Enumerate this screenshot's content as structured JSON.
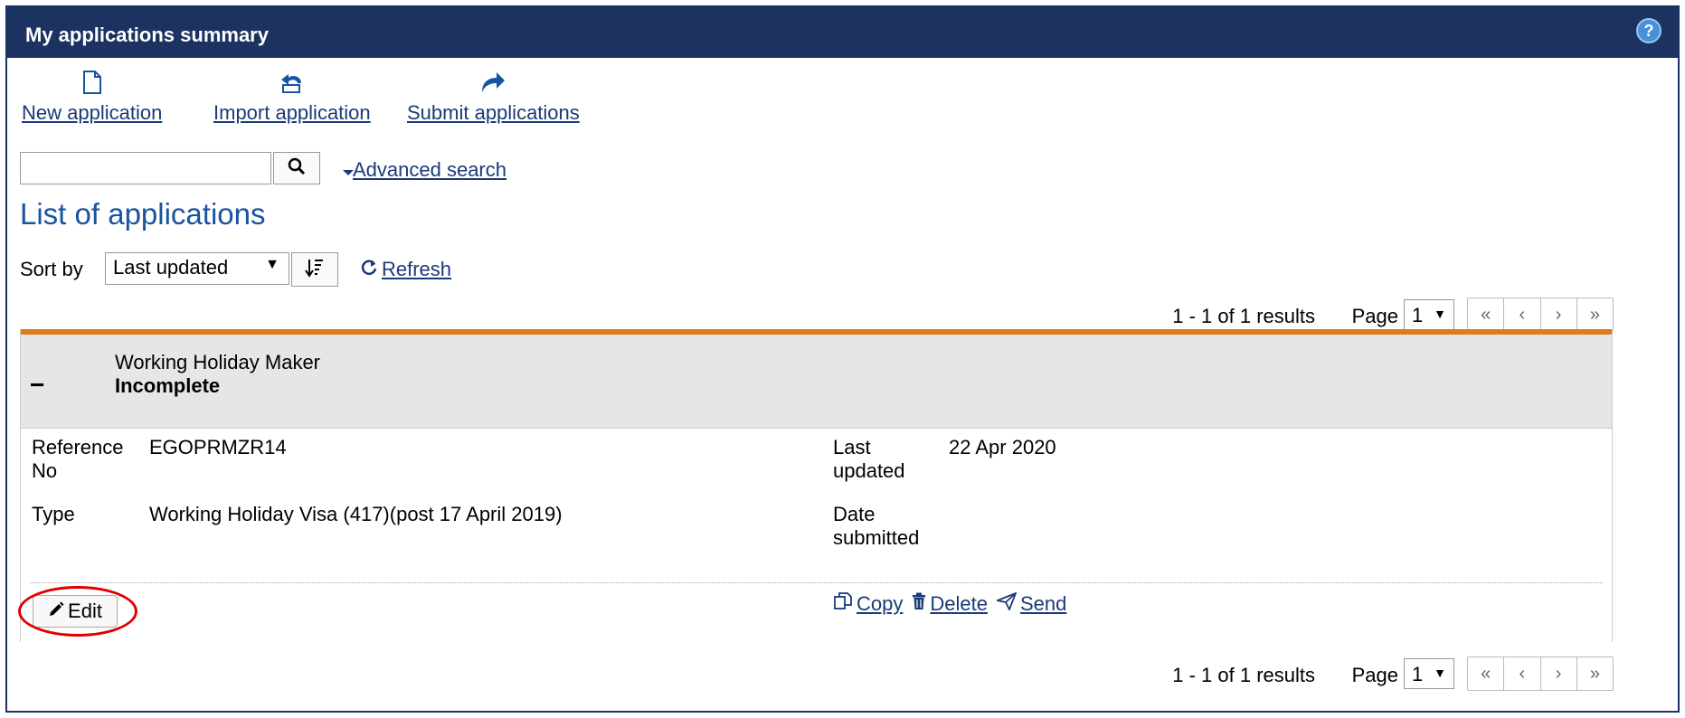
{
  "header": {
    "title": "My applications summary",
    "help_icon": "?"
  },
  "actions": [
    {
      "label": "New application",
      "icon": "document-icon"
    },
    {
      "label": "Import application",
      "icon": "import-arrow-icon"
    },
    {
      "label": "Submit applications",
      "icon": "submit-arrow-icon"
    }
  ],
  "search": {
    "value": "",
    "placeholder": "",
    "advanced_label": "Advanced search"
  },
  "list": {
    "title": "List of applications",
    "sort_label": "Sort by",
    "sort_value": "Last updated",
    "refresh_label": "Refresh"
  },
  "pagination": {
    "results": "1 - 1 of 1 results",
    "page_label": "Page",
    "page_value": "1",
    "nav": [
      "«",
      "‹",
      "›",
      "»"
    ]
  },
  "application": {
    "collapse_symbol": "−",
    "name": "Working Holiday Maker",
    "status": "Incomplete",
    "reference_label": "Reference No",
    "reference_label_1": "Reference",
    "reference_label_2": "No",
    "reference_value": "EGOPRMZR14",
    "type_label": "Type",
    "type_value": "Working Holiday Visa (417)(post 17 April 2019)",
    "last_updated_label_1": "Last",
    "last_updated_label_2": "updated",
    "last_updated_value": "22 Apr 2020",
    "date_submitted_label_1": "Date",
    "date_submitted_label_2": "submitted",
    "date_submitted_value": "",
    "edit_label": "Edit",
    "copy_label": "Copy",
    "delete_label": "Delete",
    "send_label": "Send"
  },
  "colors": {
    "header_bg": "#1c3361",
    "link": "#1a3a78",
    "title_blue": "#1a54a0",
    "accent_orange": "#e07a1e",
    "highlight_red": "#e00000"
  }
}
